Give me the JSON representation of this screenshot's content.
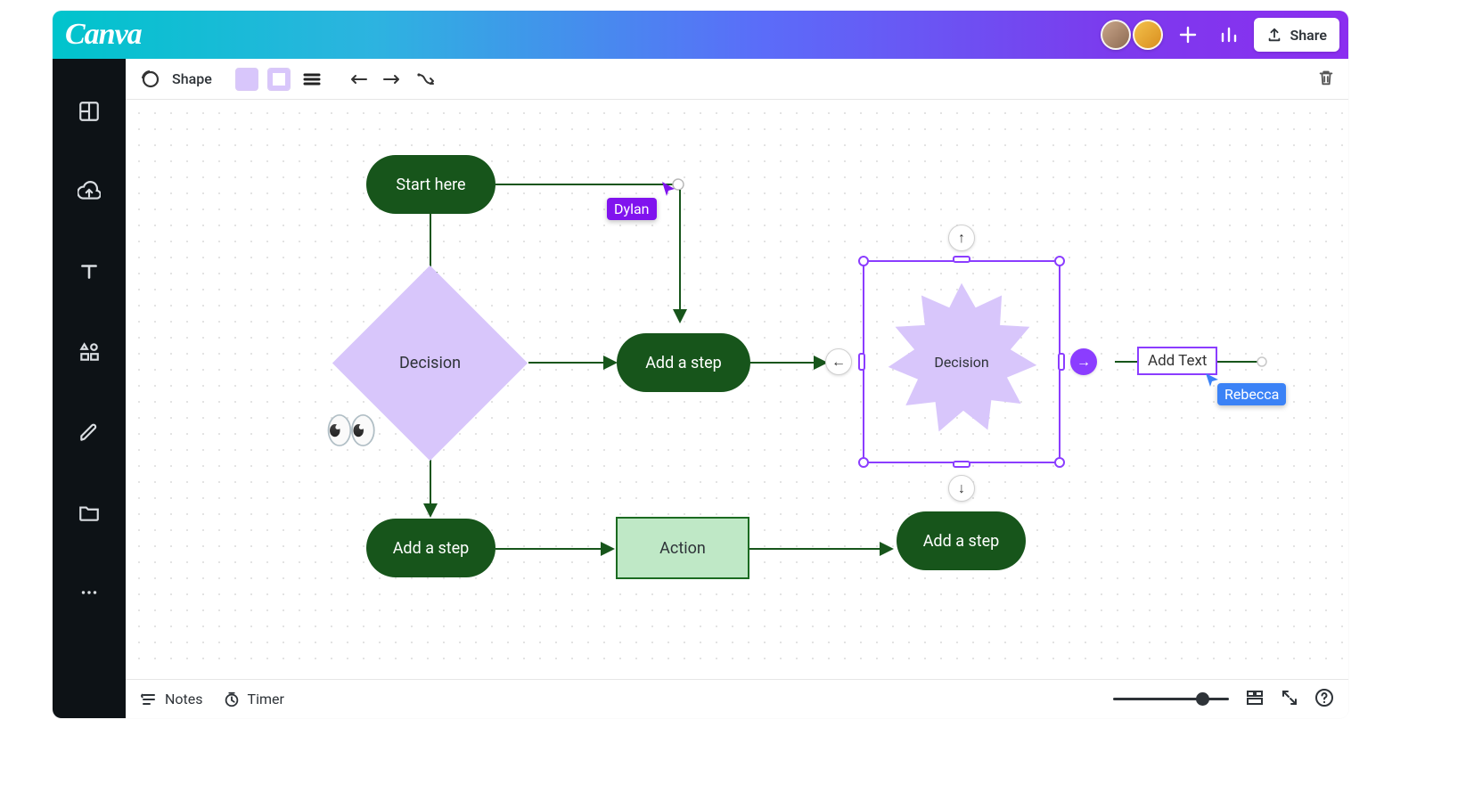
{
  "header": {
    "brand": "Canva",
    "share_label": "Share"
  },
  "toolbar": {
    "shape_label": "Shape"
  },
  "collaborators": {
    "dylan": "Dylan",
    "rebecca": "Rebecca"
  },
  "nodes": {
    "start": "Start here",
    "decision1": "Decision",
    "add_step_mid": "Add a step",
    "decision2": "Decision",
    "add_step_bottom": "Add a step",
    "action": "Action",
    "add_step_right": "Add a step",
    "add_text": "Add Text"
  },
  "footer": {
    "notes": "Notes",
    "timer": "Timer"
  },
  "colors": {
    "accent": "#8b3dff",
    "green_dark": "#17551b",
    "lilac": "#d8c6fb"
  }
}
